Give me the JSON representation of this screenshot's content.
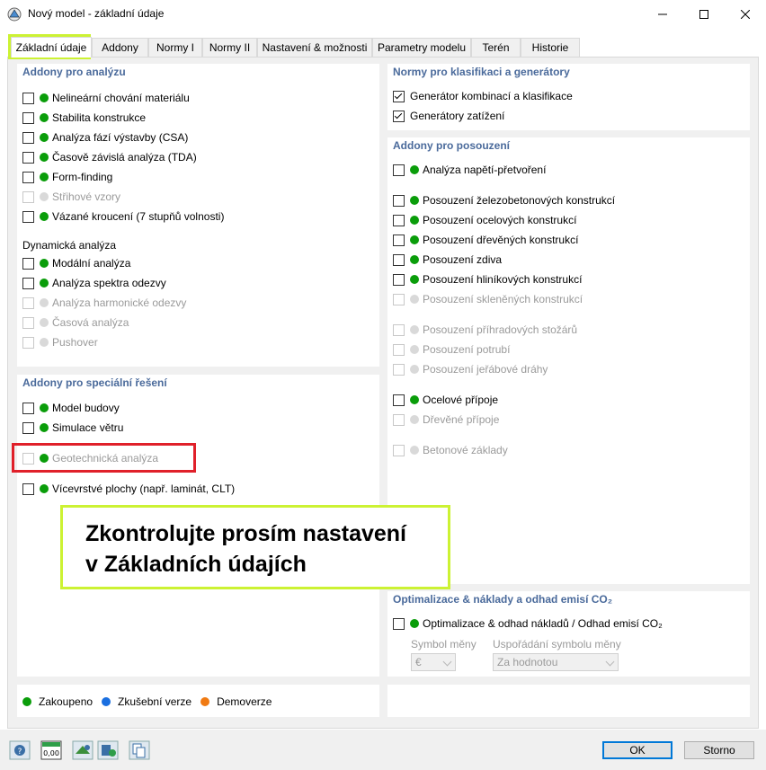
{
  "window": {
    "title": "Nový model - základní údaje",
    "minimize": "–",
    "maximize": "☐",
    "close": "✕"
  },
  "tabs": [
    "Základní údaje",
    "Addony",
    "Normy I",
    "Normy II",
    "Nastavení & možnosti",
    "Parametry modelu",
    "Terén",
    "Historie"
  ],
  "active_tab": "Základní údaje",
  "analysis": {
    "title": "Addony pro analýzu",
    "items": [
      {
        "label": "Nelineární chování materiálu",
        "enabled": true,
        "checked": false,
        "dot": "green"
      },
      {
        "label": "Stabilita konstrukce",
        "enabled": true,
        "checked": false,
        "dot": "green"
      },
      {
        "label": "Analýza fází výstavby (CSA)",
        "enabled": true,
        "checked": false,
        "dot": "green"
      },
      {
        "label": "Časově závislá analýza (TDA)",
        "enabled": true,
        "checked": false,
        "dot": "green"
      },
      {
        "label": "Form-finding",
        "enabled": true,
        "checked": false,
        "dot": "green"
      },
      {
        "label": "Střihové vzory",
        "enabled": false,
        "checked": false,
        "dot": "gray"
      },
      {
        "label": "Vázané kroucení (7 stupňů volnosti)",
        "enabled": true,
        "checked": false,
        "dot": "green"
      }
    ],
    "dynamic_title": "Dynamická analýza",
    "dynamic_items": [
      {
        "label": "Modální analýza",
        "enabled": true,
        "checked": false,
        "dot": "green"
      },
      {
        "label": "Analýza spektra odezvy",
        "enabled": true,
        "checked": false,
        "dot": "green"
      },
      {
        "label": "Analýza harmonické odezvy",
        "enabled": false,
        "checked": false,
        "dot": "gray"
      },
      {
        "label": "Časová analýza",
        "enabled": false,
        "checked": false,
        "dot": "gray"
      },
      {
        "label": "Pushover",
        "enabled": false,
        "checked": false,
        "dot": "gray"
      }
    ]
  },
  "special": {
    "title": "Addony pro speciální řešení",
    "items": [
      {
        "label": "Model budovy",
        "enabled": true,
        "checked": false,
        "dot": "green"
      },
      {
        "label": "Simulace větru",
        "enabled": true,
        "checked": false,
        "dot": "green"
      },
      {
        "label": "Geotechnická analýza",
        "enabled": false,
        "checked": false,
        "dot": "green"
      },
      {
        "label": "Vícevrstvé plochy (např. laminát, CLT)",
        "enabled": true,
        "checked": false,
        "dot": "green"
      }
    ]
  },
  "norms": {
    "title": "Normy pro klasifikaci a generátory",
    "items": [
      {
        "label": "Generátor kombinací a klasifikace",
        "enabled": true,
        "checked": true
      },
      {
        "label": "Generátory zatížení",
        "enabled": true,
        "checked": true
      }
    ]
  },
  "design": {
    "title": "Addony pro posouzení",
    "items": [
      {
        "label": "Analýza napětí-přetvoření",
        "enabled": true,
        "checked": false,
        "dot": "green"
      },
      {
        "label": "Posouzení železobetonových konstrukcí",
        "enabled": true,
        "checked": false,
        "dot": "green"
      },
      {
        "label": "Posouzení ocelových konstrukcí",
        "enabled": true,
        "checked": false,
        "dot": "green"
      },
      {
        "label": "Posouzení dřevěných konstrukcí",
        "enabled": true,
        "checked": false,
        "dot": "green"
      },
      {
        "label": "Posouzení zdiva",
        "enabled": true,
        "checked": false,
        "dot": "green"
      },
      {
        "label": "Posouzení hliníkových konstrukcí",
        "enabled": true,
        "checked": false,
        "dot": "green"
      },
      {
        "label": "Posouzení skleněných konstrukcí",
        "enabled": false,
        "checked": false,
        "dot": "gray"
      },
      {
        "label": "Posouzení příhradových stožárů",
        "enabled": false,
        "checked": false,
        "dot": "gray"
      },
      {
        "label": "Posouzení potrubí",
        "enabled": false,
        "checked": false,
        "dot": "gray"
      },
      {
        "label": "Posouzení jeřábové dráhy",
        "enabled": false,
        "checked": false,
        "dot": "gray"
      },
      {
        "label": "Ocelové přípoje",
        "enabled": true,
        "checked": false,
        "dot": "green"
      },
      {
        "label": "Dřevěné přípoje",
        "enabled": false,
        "checked": false,
        "dot": "gray"
      },
      {
        "label": "Betonové základy",
        "enabled": false,
        "checked": false,
        "dot": "gray"
      }
    ]
  },
  "optimization": {
    "title": "Optimalizace & náklady a odhad emisí CO₂",
    "item": {
      "label": "Optimalizace & odhad nákladů / Odhad emisí CO₂",
      "enabled": true,
      "checked": false,
      "dot": "green"
    },
    "symbol_label": "Symbol měny",
    "arrangement_label": "Uspořádání symbolu měny",
    "symbol_value": "€",
    "arrangement_value": "Za hodnotou"
  },
  "legend": [
    {
      "label": "Zakoupeno",
      "color": "#0a9d0a"
    },
    {
      "label": "Zkušební verze",
      "color": "#1a6fe0"
    },
    {
      "label": "Demoverze",
      "color": "#f07a12"
    }
  ],
  "note": {
    "line1": "Zkontrolujte prosím nastavení",
    "line2": "v Základních údajích"
  },
  "bottom_icons": [
    "help-icon",
    "units-icon",
    "model-icon",
    "settings-icon",
    "copy-icon"
  ],
  "units_icon_text": "0,00",
  "buttons": {
    "ok": "OK",
    "cancel": "Storno"
  }
}
